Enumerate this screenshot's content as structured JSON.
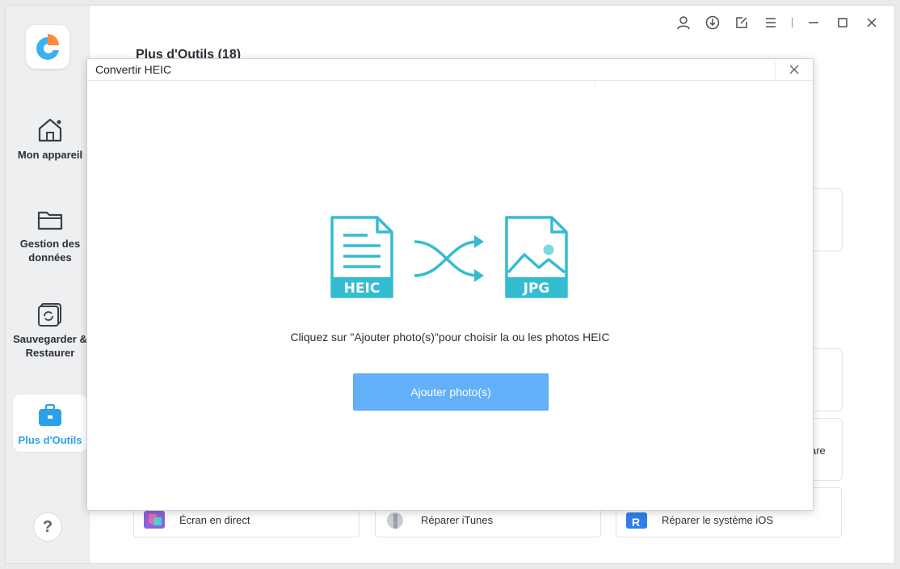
{
  "app": {
    "logo_icon": "app-logo-icon",
    "accent_color": "#2aa1e8",
    "button_color": "#62b0f8"
  },
  "sidebar": {
    "items": [
      {
        "label": "Mon appareil",
        "icon": "home-icon"
      },
      {
        "label": "Gestion des données",
        "icon": "folder-icon"
      },
      {
        "label": "Sauvegarder & Restaurer",
        "icon": "backup-icon"
      },
      {
        "label": "Plus d'Outils",
        "icon": "toolbox-icon",
        "active": true
      }
    ],
    "help_label": "?"
  },
  "titlebar": {
    "icons": [
      "user-icon",
      "download-icon",
      "edit-icon",
      "menu-icon",
      "minimize-icon",
      "maximize-icon",
      "close-icon"
    ]
  },
  "main": {
    "title": "Plus d'Outils (18)",
    "bottom_cards": [
      {
        "label": "Écran en direct"
      },
      {
        "label": "Réparer iTunes"
      },
      {
        "label": "Réparer le système iOS"
      }
    ],
    "cut_text": "are"
  },
  "modal": {
    "title": "Convertir HEIC",
    "from_format": "HEIC",
    "to_format": "JPG",
    "instruction": "Cliquez sur \"Ajouter photo(s)\"pour choisir la ou les photos HEIC",
    "add_button": "Ajouter photo(s)"
  }
}
